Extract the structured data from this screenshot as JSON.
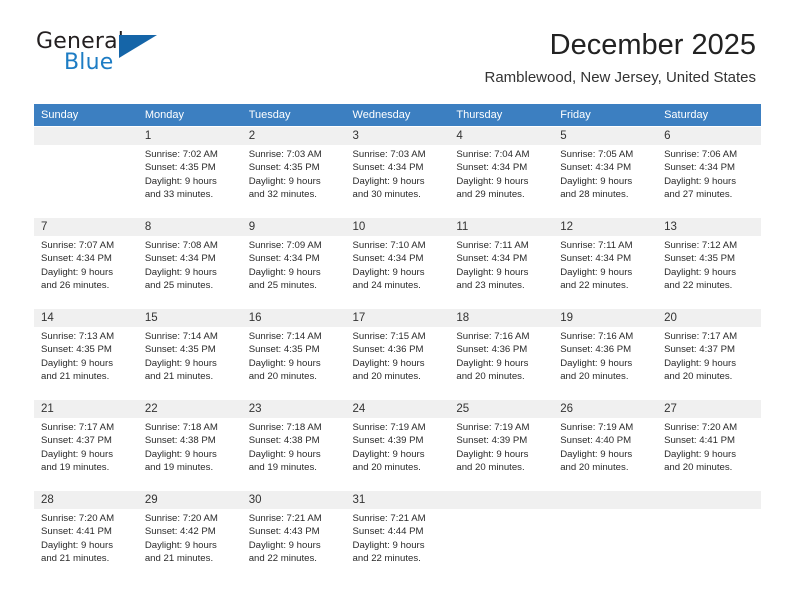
{
  "brand": {
    "line1": "General",
    "line2": "Blue",
    "triangle_color": "#1565a8",
    "blue_color": "#1d7cc4"
  },
  "header": {
    "title": "December 2025",
    "location": "Ramblewood, New Jersey, United States"
  },
  "theme": {
    "header_bg": "#3c7fc1",
    "daynum_bg": "#f0f0f0",
    "text": "#2a2a2a"
  },
  "weekday_headers": [
    "Sunday",
    "Monday",
    "Tuesday",
    "Wednesday",
    "Thursday",
    "Friday",
    "Saturday"
  ],
  "weeks": [
    [
      {
        "day": "",
        "sunrise": "",
        "sunset": "",
        "daylight1": "",
        "daylight2": "",
        "empty": true
      },
      {
        "day": "1",
        "sunrise": "Sunrise: 7:02 AM",
        "sunset": "Sunset: 4:35 PM",
        "daylight1": "Daylight: 9 hours",
        "daylight2": "and 33 minutes."
      },
      {
        "day": "2",
        "sunrise": "Sunrise: 7:03 AM",
        "sunset": "Sunset: 4:35 PM",
        "daylight1": "Daylight: 9 hours",
        "daylight2": "and 32 minutes."
      },
      {
        "day": "3",
        "sunrise": "Sunrise: 7:03 AM",
        "sunset": "Sunset: 4:34 PM",
        "daylight1": "Daylight: 9 hours",
        "daylight2": "and 30 minutes."
      },
      {
        "day": "4",
        "sunrise": "Sunrise: 7:04 AM",
        "sunset": "Sunset: 4:34 PM",
        "daylight1": "Daylight: 9 hours",
        "daylight2": "and 29 minutes."
      },
      {
        "day": "5",
        "sunrise": "Sunrise: 7:05 AM",
        "sunset": "Sunset: 4:34 PM",
        "daylight1": "Daylight: 9 hours",
        "daylight2": "and 28 minutes."
      },
      {
        "day": "6",
        "sunrise": "Sunrise: 7:06 AM",
        "sunset": "Sunset: 4:34 PM",
        "daylight1": "Daylight: 9 hours",
        "daylight2": "and 27 minutes."
      }
    ],
    [
      {
        "day": "7",
        "sunrise": "Sunrise: 7:07 AM",
        "sunset": "Sunset: 4:34 PM",
        "daylight1": "Daylight: 9 hours",
        "daylight2": "and 26 minutes."
      },
      {
        "day": "8",
        "sunrise": "Sunrise: 7:08 AM",
        "sunset": "Sunset: 4:34 PM",
        "daylight1": "Daylight: 9 hours",
        "daylight2": "and 25 minutes."
      },
      {
        "day": "9",
        "sunrise": "Sunrise: 7:09 AM",
        "sunset": "Sunset: 4:34 PM",
        "daylight1": "Daylight: 9 hours",
        "daylight2": "and 25 minutes."
      },
      {
        "day": "10",
        "sunrise": "Sunrise: 7:10 AM",
        "sunset": "Sunset: 4:34 PM",
        "daylight1": "Daylight: 9 hours",
        "daylight2": "and 24 minutes."
      },
      {
        "day": "11",
        "sunrise": "Sunrise: 7:11 AM",
        "sunset": "Sunset: 4:34 PM",
        "daylight1": "Daylight: 9 hours",
        "daylight2": "and 23 minutes."
      },
      {
        "day": "12",
        "sunrise": "Sunrise: 7:11 AM",
        "sunset": "Sunset: 4:34 PM",
        "daylight1": "Daylight: 9 hours",
        "daylight2": "and 22 minutes."
      },
      {
        "day": "13",
        "sunrise": "Sunrise: 7:12 AM",
        "sunset": "Sunset: 4:35 PM",
        "daylight1": "Daylight: 9 hours",
        "daylight2": "and 22 minutes."
      }
    ],
    [
      {
        "day": "14",
        "sunrise": "Sunrise: 7:13 AM",
        "sunset": "Sunset: 4:35 PM",
        "daylight1": "Daylight: 9 hours",
        "daylight2": "and 21 minutes."
      },
      {
        "day": "15",
        "sunrise": "Sunrise: 7:14 AM",
        "sunset": "Sunset: 4:35 PM",
        "daylight1": "Daylight: 9 hours",
        "daylight2": "and 21 minutes."
      },
      {
        "day": "16",
        "sunrise": "Sunrise: 7:14 AM",
        "sunset": "Sunset: 4:35 PM",
        "daylight1": "Daylight: 9 hours",
        "daylight2": "and 20 minutes."
      },
      {
        "day": "17",
        "sunrise": "Sunrise: 7:15 AM",
        "sunset": "Sunset: 4:36 PM",
        "daylight1": "Daylight: 9 hours",
        "daylight2": "and 20 minutes."
      },
      {
        "day": "18",
        "sunrise": "Sunrise: 7:16 AM",
        "sunset": "Sunset: 4:36 PM",
        "daylight1": "Daylight: 9 hours",
        "daylight2": "and 20 minutes."
      },
      {
        "day": "19",
        "sunrise": "Sunrise: 7:16 AM",
        "sunset": "Sunset: 4:36 PM",
        "daylight1": "Daylight: 9 hours",
        "daylight2": "and 20 minutes."
      },
      {
        "day": "20",
        "sunrise": "Sunrise: 7:17 AM",
        "sunset": "Sunset: 4:37 PM",
        "daylight1": "Daylight: 9 hours",
        "daylight2": "and 20 minutes."
      }
    ],
    [
      {
        "day": "21",
        "sunrise": "Sunrise: 7:17 AM",
        "sunset": "Sunset: 4:37 PM",
        "daylight1": "Daylight: 9 hours",
        "daylight2": "and 19 minutes."
      },
      {
        "day": "22",
        "sunrise": "Sunrise: 7:18 AM",
        "sunset": "Sunset: 4:38 PM",
        "daylight1": "Daylight: 9 hours",
        "daylight2": "and 19 minutes."
      },
      {
        "day": "23",
        "sunrise": "Sunrise: 7:18 AM",
        "sunset": "Sunset: 4:38 PM",
        "daylight1": "Daylight: 9 hours",
        "daylight2": "and 19 minutes."
      },
      {
        "day": "24",
        "sunrise": "Sunrise: 7:19 AM",
        "sunset": "Sunset: 4:39 PM",
        "daylight1": "Daylight: 9 hours",
        "daylight2": "and 20 minutes."
      },
      {
        "day": "25",
        "sunrise": "Sunrise: 7:19 AM",
        "sunset": "Sunset: 4:39 PM",
        "daylight1": "Daylight: 9 hours",
        "daylight2": "and 20 minutes."
      },
      {
        "day": "26",
        "sunrise": "Sunrise: 7:19 AM",
        "sunset": "Sunset: 4:40 PM",
        "daylight1": "Daylight: 9 hours",
        "daylight2": "and 20 minutes."
      },
      {
        "day": "27",
        "sunrise": "Sunrise: 7:20 AM",
        "sunset": "Sunset: 4:41 PM",
        "daylight1": "Daylight: 9 hours",
        "daylight2": "and 20 minutes."
      }
    ],
    [
      {
        "day": "28",
        "sunrise": "Sunrise: 7:20 AM",
        "sunset": "Sunset: 4:41 PM",
        "daylight1": "Daylight: 9 hours",
        "daylight2": "and 21 minutes."
      },
      {
        "day": "29",
        "sunrise": "Sunrise: 7:20 AM",
        "sunset": "Sunset: 4:42 PM",
        "daylight1": "Daylight: 9 hours",
        "daylight2": "and 21 minutes."
      },
      {
        "day": "30",
        "sunrise": "Sunrise: 7:21 AM",
        "sunset": "Sunset: 4:43 PM",
        "daylight1": "Daylight: 9 hours",
        "daylight2": "and 22 minutes."
      },
      {
        "day": "31",
        "sunrise": "Sunrise: 7:21 AM",
        "sunset": "Sunset: 4:44 PM",
        "daylight1": "Daylight: 9 hours",
        "daylight2": "and 22 minutes."
      },
      {
        "day": "",
        "sunrise": "",
        "sunset": "",
        "daylight1": "",
        "daylight2": "",
        "empty": true
      },
      {
        "day": "",
        "sunrise": "",
        "sunset": "",
        "daylight1": "",
        "daylight2": "",
        "empty": true
      },
      {
        "day": "",
        "sunrise": "",
        "sunset": "",
        "daylight1": "",
        "daylight2": "",
        "empty": true
      }
    ]
  ]
}
